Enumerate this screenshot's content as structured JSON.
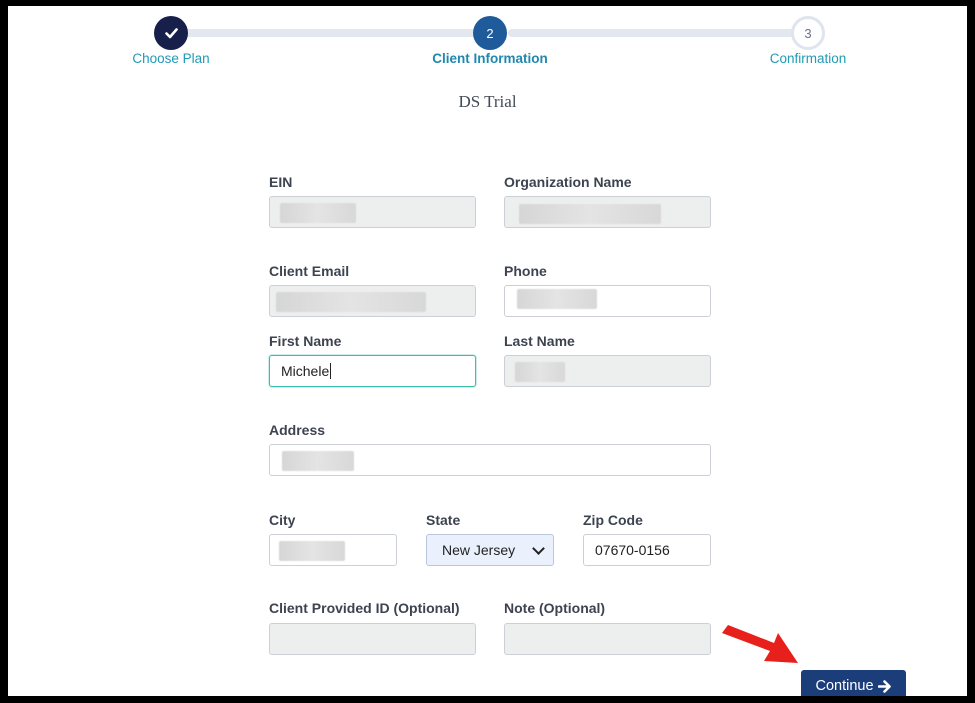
{
  "stepper": {
    "steps": [
      {
        "label": "Choose Plan",
        "marker": "",
        "state": "done"
      },
      {
        "label": "Client Information",
        "marker": "2",
        "state": "active"
      },
      {
        "label": "Confirmation",
        "marker": "3",
        "state": "pending"
      }
    ]
  },
  "page_title": "DS Trial",
  "form": {
    "ein": {
      "label": "EIN",
      "value": ""
    },
    "organization_name": {
      "label": "Organization Name",
      "value": ""
    },
    "client_email": {
      "label": "Client Email",
      "value": ""
    },
    "phone": {
      "label": "Phone",
      "value": ""
    },
    "first_name": {
      "label": "First Name",
      "value": "Michele"
    },
    "last_name": {
      "label": "Last Name",
      "value": ""
    },
    "address": {
      "label": "Address",
      "value": ""
    },
    "city": {
      "label": "City",
      "value": ""
    },
    "state": {
      "label": "State",
      "value": "New Jersey"
    },
    "zip_code": {
      "label": "Zip Code",
      "value": "07670-0156"
    },
    "client_provided_id": {
      "label": "Client Provided ID (Optional)",
      "value": ""
    },
    "note": {
      "label": "Note (Optional)",
      "value": ""
    }
  },
  "continue_label": "Continue",
  "colors": {
    "step_done": "#16204a",
    "step_active": "#1f5b9a",
    "step_label": "#1f9bb5",
    "button": "#1b3d7a",
    "focus_border": "#3dbcb0",
    "annotation_arrow": "#e8201b"
  }
}
